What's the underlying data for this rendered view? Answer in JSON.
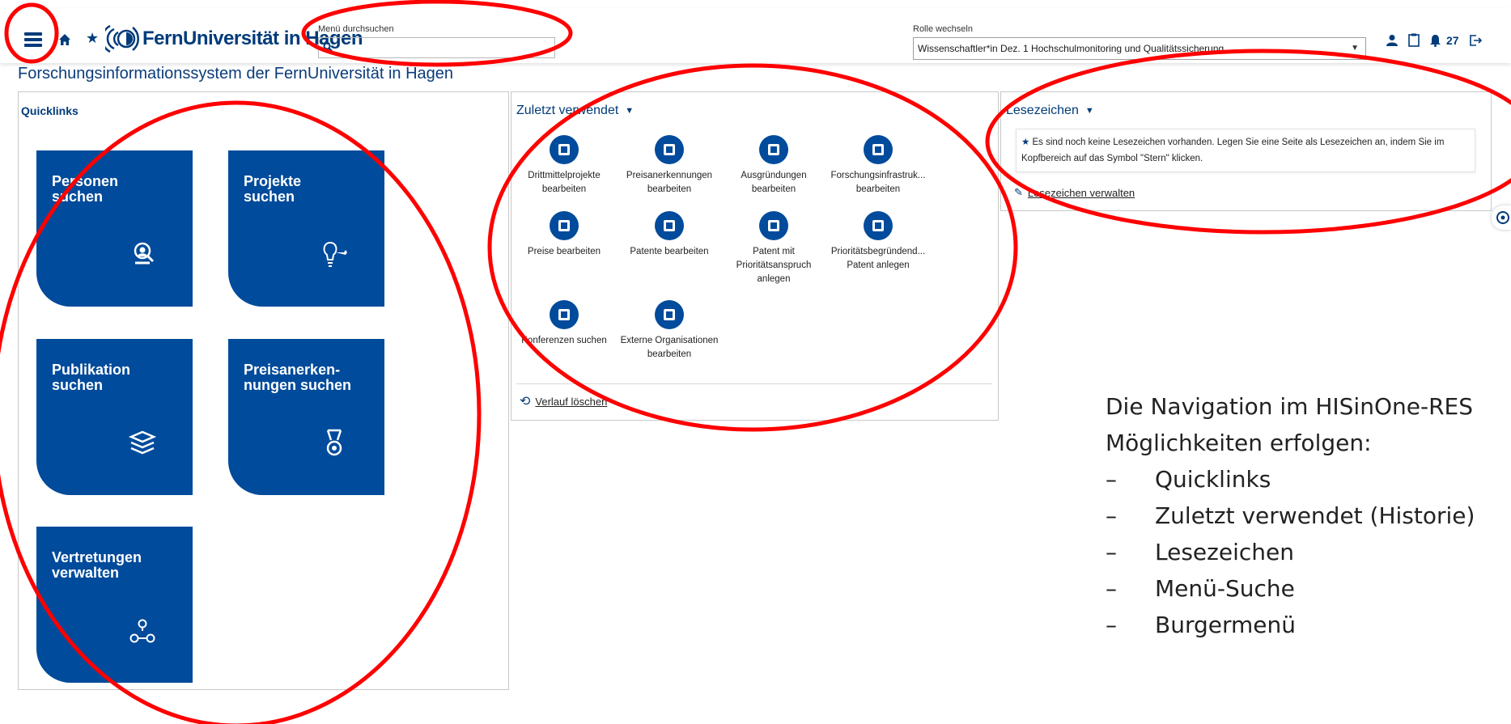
{
  "header": {
    "logo_text": "FernUniversität in Hagen",
    "menu_search_label": "Menü durchsuchen",
    "menu_search_value": "",
    "role_label": "Rolle wechseln",
    "role_value": "Wissenschaftler*in Dez. 1 Hochschulmonitoring und Qualitätssicherung",
    "notification_count": "27",
    "icons": [
      "burger-menu-icon",
      "home-icon",
      "star-icon",
      "user-icon",
      "clipboard-icon",
      "bell-icon",
      "logout-icon"
    ]
  },
  "page_title": "Forschungsinformationssystem der FernUniversität in Hagen",
  "quicklinks": {
    "title": "Quicklinks",
    "tiles": [
      {
        "label": "Personen\nsuchen",
        "icon": "person-search-icon"
      },
      {
        "label": "Projekte\nsuchen",
        "icon": "lightbulb-key-icon"
      },
      {
        "label": "Publikation\nsuchen",
        "icon": "books-icon"
      },
      {
        "label": "Preisanerken-\nnungen suchen",
        "icon": "medal-icon"
      },
      {
        "label": "Vertretungen\nverwalten",
        "icon": "people-network-icon"
      }
    ]
  },
  "recent": {
    "title": "Zuletzt verwendet",
    "items": [
      "Drittmittelprojekte bearbeiten",
      "Preisanerkennungen bearbeiten",
      "Ausgründungen bearbeiten",
      "Forschungsinfrastruk... bearbeiten",
      "Preise bearbeiten",
      "Patente bearbeiten",
      "Patent mit Prioritätsanspruch anlegen",
      "Prioritätsbegründend... Patent anlegen",
      "Konferenzen suchen",
      "Externe Organisationen bearbeiten"
    ],
    "clear_history": "Verlauf löschen"
  },
  "bookmarks": {
    "title": "Lesezeichen",
    "empty_note": "Es sind noch keine Lesezeichen vorhanden. Legen Sie eine Seite als Lesezeichen an, indem Sie im Kopfbereich auf das Symbol \"Stern\" klicken.",
    "manage_link": "Lesezeichen verwalten"
  },
  "notes": {
    "intro": "Die Navigation im HISinOne-RES",
    "intro2": "Möglichkeiten erfolgen:",
    "items": [
      "Quicklinks",
      "Zuletzt verwendet (Historie)",
      "Lesezeichen",
      "Menü-Suche",
      "Burgermenü"
    ]
  },
  "colors": {
    "brand": "#004b9b",
    "annotation": "#ff0000"
  }
}
